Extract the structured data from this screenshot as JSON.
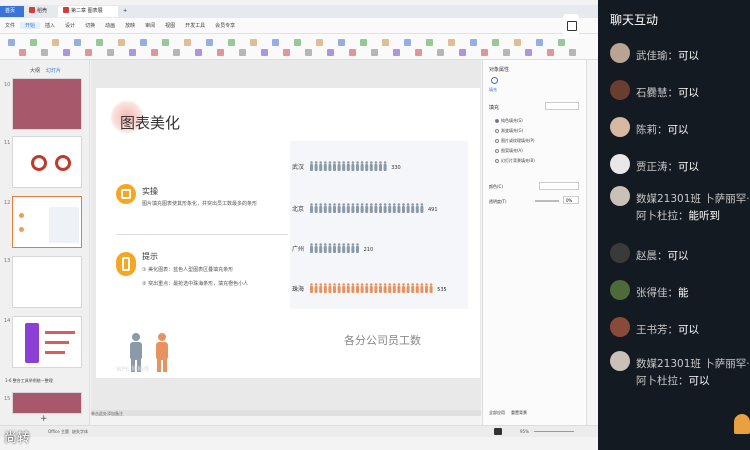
{
  "titlebar": {
    "home": "首页",
    "docer": "稻壳",
    "file_tab": "第二章 图表展示.pptx"
  },
  "menus": [
    "文件",
    "开始",
    "插入",
    "设计",
    "切换",
    "动画",
    "放映",
    "审阅",
    "视图",
    "开发工具",
    "会员专享"
  ],
  "sidebar": {
    "tabs": [
      "大纲",
      "幻灯片"
    ],
    "numbers": [
      "10",
      "11",
      "12",
      "13",
      "14",
      "15"
    ],
    "section_label": "1-6 整合工具举例统一整理"
  },
  "slide": {
    "title": "图表美化",
    "practice_heading": "实操",
    "practice_text": "图片填充图表使其形象化，并突出员工数最多的条形",
    "tips_heading": "提示",
    "tip1": "① 美化图表：蓝色人型图表区叠填充条形",
    "tip2": "② 突出重点：最抢选中珠海条形，填充橙色小人",
    "watermark": "WPS 和稻壳"
  },
  "chart_data": {
    "type": "bar",
    "title": "各分公司员工数",
    "categories": [
      "武汉",
      "北京",
      "广州",
      "珠海"
    ],
    "values": [
      330,
      491,
      210,
      535
    ],
    "series": [
      {
        "values": [
          330,
          491,
          210,
          535
        ]
      }
    ],
    "colors": {
      "normal": "#8a9aa8",
      "highlight": "#e8935f"
    }
  },
  "rightpanel": {
    "title": "对象属性",
    "tab_fill": "填充",
    "fill_section": "填充",
    "options": [
      "纯色填充(S)",
      "渐变填充(G)",
      "图片或纹理填充(P)",
      "图案填充(A)",
      "幻灯片背景填充(B)"
    ],
    "color_label": "颜色(C)",
    "transparency_label": "透明度(T)",
    "transparency_value": "0%",
    "apply_all": "全部应用",
    "reset_bg": "重置背景"
  },
  "notes": "单击此处添加备注",
  "statusbar": {
    "theme": "Office 主题",
    "missing_font": "缺失字体",
    "zoom": "95%"
  },
  "overlay_text": "尚转",
  "chat": {
    "title": "聊天互动",
    "messages": [
      {
        "name": "武佳瑜",
        "text": "可以"
      },
      {
        "name": "石爨慧",
        "text": "可以"
      },
      {
        "name": "陈莉",
        "text": "可以"
      },
      {
        "name": "贾正涛",
        "text": "可以"
      },
      {
        "name": "数媒21301班 卜萨丽罕·阿卜杜拉",
        "text": "能听到"
      },
      {
        "name": "赵晨",
        "text": "可以"
      },
      {
        "name": "张得佳",
        "text": "能"
      },
      {
        "name": "王书芳",
        "text": "可以"
      },
      {
        "name": "数媒21301班 卜萨丽罕·阿卜杜拉",
        "text": "可以"
      }
    ]
  }
}
